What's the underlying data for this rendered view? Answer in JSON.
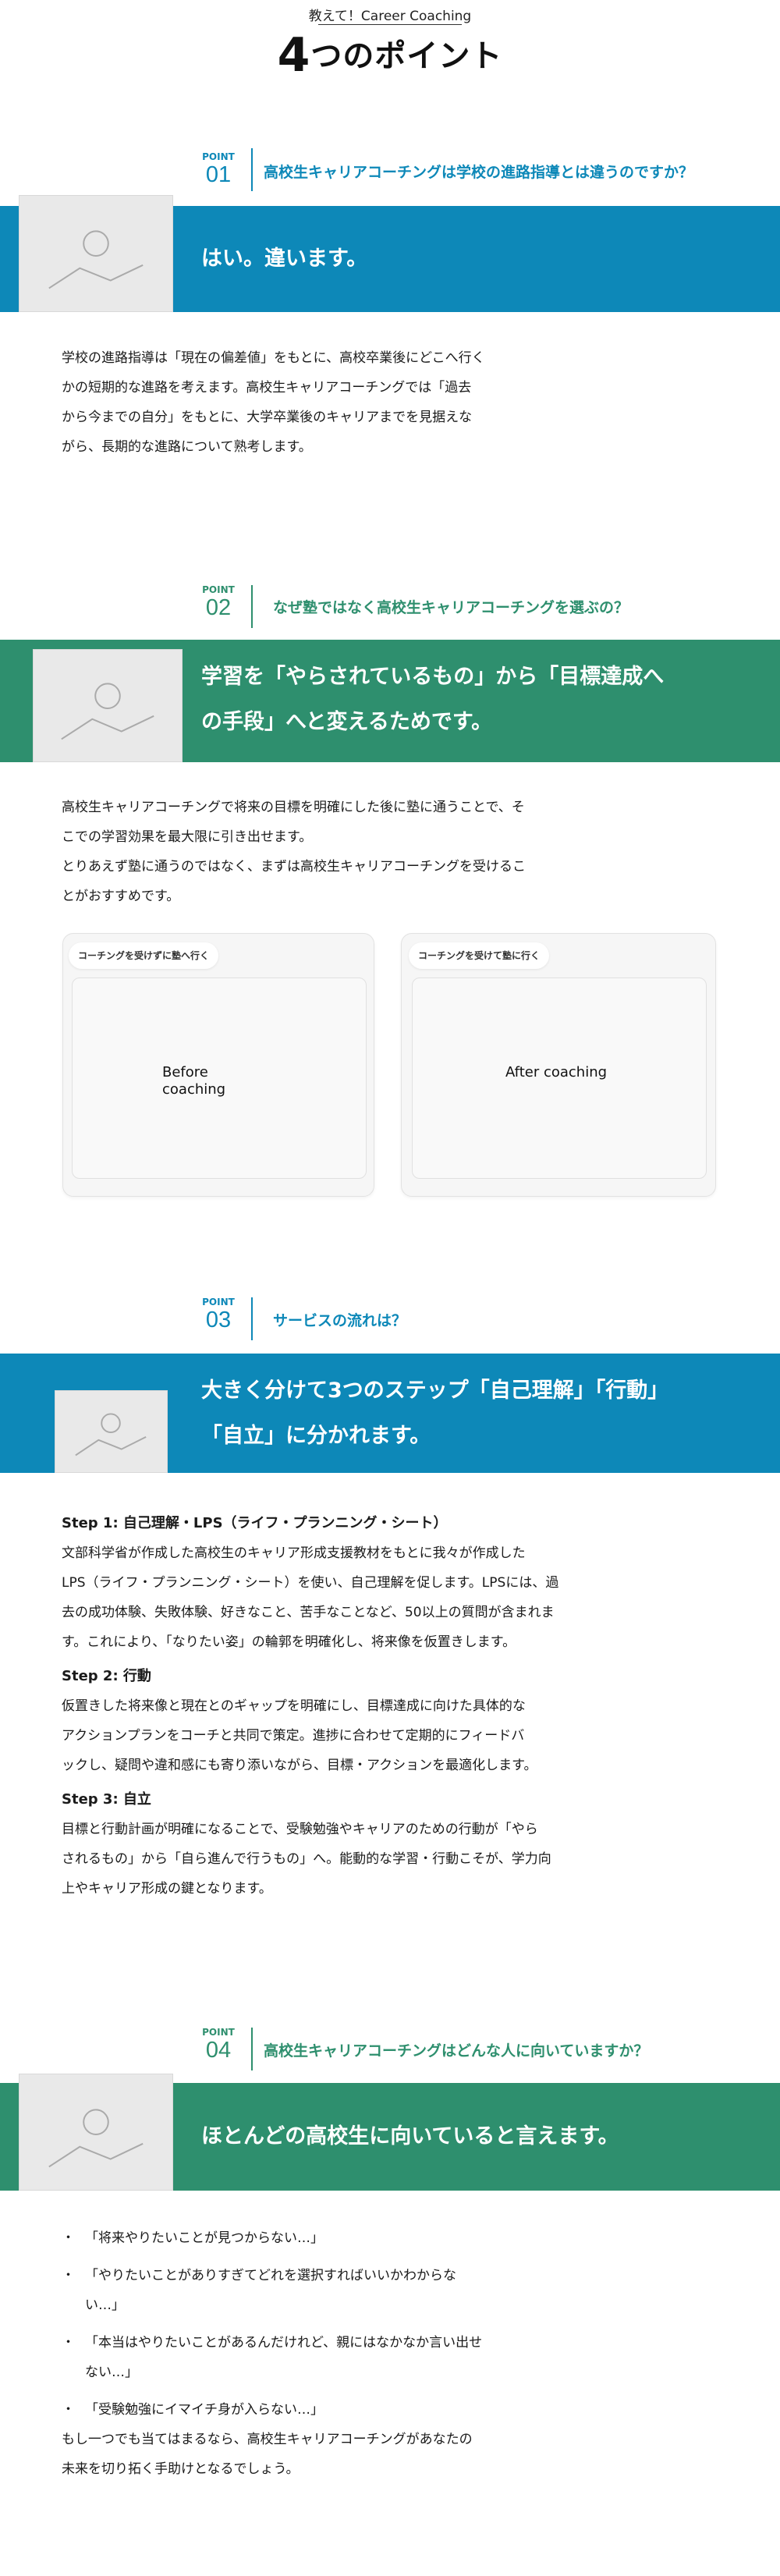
{
  "header": {
    "subtitle": "教えて！Career Coaching",
    "number": "4",
    "title": "つのポイント"
  },
  "points": [
    {
      "label": "POINT",
      "num": "01",
      "question": "高校生キャリアコーチングは学校の進路指導とは違うのですか？",
      "answer": "はい。違います。",
      "body": [
        "学校の進路指導は「現在の偏差値」をもとに、高校卒業後にどこへ行く",
        "かの短期的な進路を考えます。高校生キャリアコーチングでは「過去",
        "から今までの自分」をもとに、大学卒業後のキャリアまでを見据えな",
        "がら、長期的な進路について熟考します。"
      ]
    },
    {
      "label": "POINT",
      "num": "02",
      "question": "なぜ塾ではなく高校生キャリアコーチングを選ぶの？",
      "answer_lines": [
        "学習を「やらされているもの」から「目標達成へ",
        "の手段」へと変えるためです。"
      ],
      "body": [
        "高校生キャリアコーチングで将来の目標を明確にした後に塾に通うことで、そ",
        "こでの学習効果を最大限に引き出せます。",
        "とりあえず塾に通うのではなく、まずは高校生キャリアコーチングを受けるこ",
        "とがおすすめです。"
      ],
      "cards": [
        {
          "pill": "コーチングを受けずに塾へ行く",
          "caption": "Before coaching"
        },
        {
          "pill": "コーチングを受けて塾に行く",
          "caption": "After coaching"
        }
      ]
    },
    {
      "label": "POINT",
      "num": "03",
      "question": "サービスの流れは？",
      "answer_lines": [
        "大きく分けて3つのステップ「自己理解」「行動」",
        "「自立」に分かれます。"
      ],
      "steps": [
        {
          "title": "Step 1: 自己理解・LPS（ライフ・プランニング・シート）",
          "lines": [
            "文部科学省が作成した高校生のキャリア形成支援教材をもとに我々が作成した",
            "LPS（ライフ・プランニング・シート）を使い、自己理解を促します。LPSには、過",
            "去の成功体験、失敗体験、好きなこと、苦手なことなど、50以上の質問が含まれま",
            "す。これにより、「なりたい姿」の輪郭を明確化し、将来像を仮置きします。"
          ]
        },
        {
          "title": "Step 2: 行動",
          "lines": [
            "仮置きした将来像と現在とのギャップを明確にし、目標達成に向けた具体的な",
            "アクションプランをコーチと共同で策定。進捗に合わせて定期的にフィードバ",
            "ックし、疑問や違和感にも寄り添いながら、目標・アクションを最適化します。"
          ]
        },
        {
          "title": "Step 3: 自立",
          "lines": [
            "目標と行動計画が明確になることで、受験勉強やキャリアのための行動が「やら",
            "されるもの」から「自ら進んで行うもの」へ。能動的な学習・行動こそが、学力向",
            "上やキャリア形成の鍵となります。"
          ]
        }
      ]
    },
    {
      "label": "POINT",
      "num": "04",
      "question": "高校生キャリアコーチングはどんな人に向いていますか？",
      "answer": "ほとんどの高校生に向いていると言えます。",
      "bullets": [
        [
          "「将来やりたいことが見つからない…」"
        ],
        [
          "「やりたいことがありすぎてどれを選択すればいいかわからな",
          "い…」"
        ],
        [
          "「本当はやりたいことがあるんだけれど、親にはなかなか言い出せ",
          "ない…」"
        ],
        [
          "「受験勉強にイマイチ身が入らない…」"
        ]
      ],
      "closing": [
        "もし一つでも当てはまるなら、高校生キャリアコーチングがあなたの",
        "未来を切り拓く手助けとなるでしょう。"
      ]
    }
  ]
}
